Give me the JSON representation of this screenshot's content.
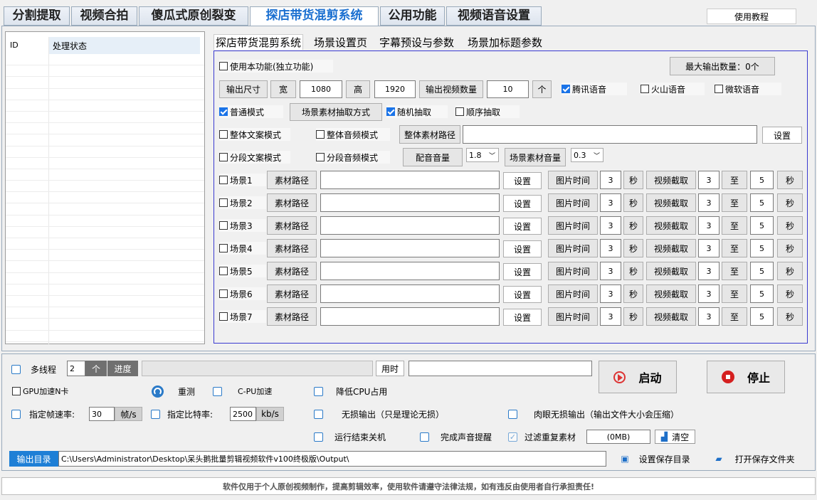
{
  "tabs": [
    "分割提取",
    "视频合拍",
    "傻瓜式原创裂变",
    "探店带货混剪系统",
    "公用功能",
    "视频语音设置"
  ],
  "help_button": "使用教程",
  "list": {
    "col_id": "ID",
    "col_status": "处理状态"
  },
  "subtabs": [
    "探店带货混剪系统",
    "场景设置页",
    "字幕预设与参数",
    "场景加标题参数"
  ],
  "max_output": "最大输出数量：0个",
  "use_feature": "使用本功能(独立功能)",
  "size_row": {
    "output_size": "输出尺寸",
    "width_label": "宽",
    "width": "1080",
    "height_label": "高",
    "height": "1920",
    "count_label": "输出视频数量",
    "count": "10",
    "unit": "个"
  },
  "voices": [
    "腾讯语音",
    "火山语音",
    "微软语音"
  ],
  "mode_row": {
    "normal": "普通模式",
    "extract_method": "场景素材抽取方式",
    "random": "随机抽取",
    "sequential": "顺序抽取"
  },
  "whole_row": {
    "text_mode": "整体文案模式",
    "audio_mode": "整体音频模式",
    "path_btn": "整体素材路径",
    "path": "",
    "set": "设置"
  },
  "seg_row": {
    "text_mode": "分段文案模式",
    "audio_mode": "分段音频模式",
    "dub_vol": "配音音量",
    "dub_val": "1.8",
    "scene_vol": "场景素材音量",
    "scene_val": "0.3"
  },
  "scenes": [
    {
      "label": "场景1",
      "path_btn": "素材路径",
      "path": "",
      "set": "设置",
      "img_time": "图片时间",
      "img_val": "3",
      "sec": "秒",
      "clip": "视频截取",
      "from": "3",
      "to_label": "至",
      "to": "5",
      "sec2": "秒"
    },
    {
      "label": "场景2",
      "path_btn": "素材路径",
      "path": "",
      "set": "设置",
      "img_time": "图片时间",
      "img_val": "3",
      "sec": "秒",
      "clip": "视频截取",
      "from": "3",
      "to_label": "至",
      "to": "5",
      "sec2": "秒"
    },
    {
      "label": "场景3",
      "path_btn": "素材路径",
      "path": "",
      "set": "设置",
      "img_time": "图片时间",
      "img_val": "3",
      "sec": "秒",
      "clip": "视频截取",
      "from": "3",
      "to_label": "至",
      "to": "5",
      "sec2": "秒"
    },
    {
      "label": "场景4",
      "path_btn": "素材路径",
      "path": "",
      "set": "设置",
      "img_time": "图片时间",
      "img_val": "3",
      "sec": "秒",
      "clip": "视频截取",
      "from": "3",
      "to_label": "至",
      "to": "5",
      "sec2": "秒"
    },
    {
      "label": "场景5",
      "path_btn": "素材路径",
      "path": "",
      "set": "设置",
      "img_time": "图片时间",
      "img_val": "3",
      "sec": "秒",
      "clip": "视频截取",
      "from": "3",
      "to_label": "至",
      "to": "5",
      "sec2": "秒"
    },
    {
      "label": "场景6",
      "path_btn": "素材路径",
      "path": "",
      "set": "设置",
      "img_time": "图片时间",
      "img_val": "3",
      "sec": "秒",
      "clip": "视频截取",
      "from": "3",
      "to_label": "至",
      "to": "5",
      "sec2": "秒"
    },
    {
      "label": "场景7",
      "path_btn": "素材路径",
      "path": "",
      "set": "设置",
      "img_time": "图片时间",
      "img_val": "3",
      "sec": "秒",
      "clip": "视频截取",
      "from": "3",
      "to_label": "至",
      "to": "5",
      "sec2": "秒"
    }
  ],
  "bottom": {
    "multithread": "多线程",
    "threads": "2",
    "thread_unit": "个",
    "progress": "进度",
    "time_used": "用时",
    "time_val": "",
    "start": "启动",
    "stop": "停止",
    "gpu": "GPU加速N卡",
    "retest": "重测",
    "cpu_accel": "C-PU加速",
    "low_cpu": "降低CPU占用",
    "fps_label": "指定帧速率:",
    "fps": "30",
    "fps_unit": "帧/s",
    "bitrate_label": "指定比特率:",
    "bitrate": "2500",
    "bitrate_unit": "kb/s",
    "lossless": "无损输出（只是理论无损）",
    "visual_lossless": "肉眼无损输出（输出文件大小会压缩）",
    "shutdown": "运行结束关机",
    "sound": "完成声音提醒",
    "filter_dup": "过滤重复素材",
    "cache": "(0MB)",
    "clear": "清空",
    "out_dir_label": "输出目录",
    "out_dir": "C:\\Users\\Administrator\\Desktop\\呆头鹅批量剪辑视频软件v100终极版\\Output\\",
    "set_save": "设置保存目录",
    "open_save": "打开保存文件夹"
  },
  "footer": "软件仅用于个人原创视频制作，提高剪辑效率，使用软件请遵守法律法规，如有违反由使用者自行承担责任!"
}
